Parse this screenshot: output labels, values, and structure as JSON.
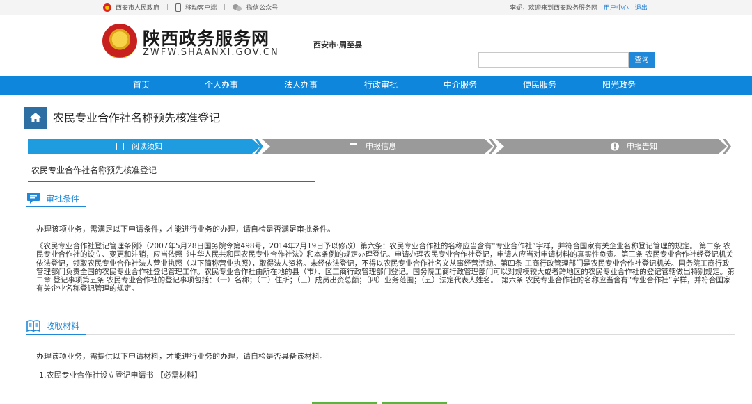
{
  "topbar": {
    "gov_link": "西安市人民政府",
    "mobile_link": "移动客户端",
    "wechat_link": "微信公众号",
    "welcome": "李妮，欢迎来到西安政务服务网",
    "user_center": "用户中心",
    "logout": "退出"
  },
  "header": {
    "site_title": "陕西政务服务网",
    "site_domain": "ZWFW.SHAANXI.GOV.CN",
    "region": "西安市·周至县",
    "search_placeholder": "",
    "search_button": "查询"
  },
  "nav": [
    "首页",
    "个人办事",
    "法人办事",
    "行政审批",
    "中介服务",
    "便民服务",
    "阳光政务"
  ],
  "page": {
    "heading": "农民专业合作社名称预先核准登记",
    "subtitle": "农民专业合作社名称预先核准登记"
  },
  "steps": [
    {
      "label": "阅读须知",
      "icon": "document-icon",
      "active": true
    },
    {
      "label": "申报信息",
      "icon": "form-icon",
      "active": false
    },
    {
      "label": "申报告知",
      "icon": "info-icon",
      "active": false
    }
  ],
  "conditions": {
    "title": "审批条件",
    "intro": "办理该项业务，需满足以下申请条件，才能进行业务的办理，请自检是否满足审批条件。",
    "body": "《农民专业合作社登记管理条例》（2007年5月28日国务院令第498号，2014年2月19日予以修改）第六条：农民专业合作社的名称应当含有“专业合作社”字样，并符合国家有关企业名称登记管理的规定。 第二条 农民专业合作社的设立、变更和注销，应当依照《中华人民共和国农民专业合作社法》和本条例的规定办理登记。申请办理农民专业合作社登记，申请人应当对申请材料的真实性负责。第三条 农民专业合作社经登记机关依法登记，领取农民专业合作社法人营业执照（以下简称营业执照），取得法人资格。未经依法登记，不得以农民专业合作社名义从事经营活动。第四条 工商行政管理部门是农民专业合作社登记机关。国务院工商行政管理部门负责全国的农民专业合作社登记管理工作。农民专业合作社由所在地的县（市）、区工商行政管理部门登记。国务院工商行政管理部门可以对规模较大或者跨地区的农民专业合作社的登记管辖做出特别规定。第二章 登记事项第五条 农民专业合作社的登记事项包括：（一）名称；（二）住所；（三）成员出资总额；（四）业务范围；（五）法定代表人姓名。　第六条 农民专业合作社的名称应当含有“专业合作社”字样，并符合国家有关企业名称登记管理的规定。"
  },
  "materials": {
    "title": "收取材料",
    "intro": "办理该项业务，需提供以下申请材料，才能进行业务的办理，请自检是否具备该材料。",
    "items": [
      "1.农民专业合作社设立登记申请书 【必需材料】"
    ]
  },
  "colors": {
    "nav_blue": "#0d86dc",
    "step_active": "#1f9be0",
    "step_inactive": "#9a9a9a",
    "heading_blue": "#2d6ea3",
    "button_green": "#59b63c"
  }
}
